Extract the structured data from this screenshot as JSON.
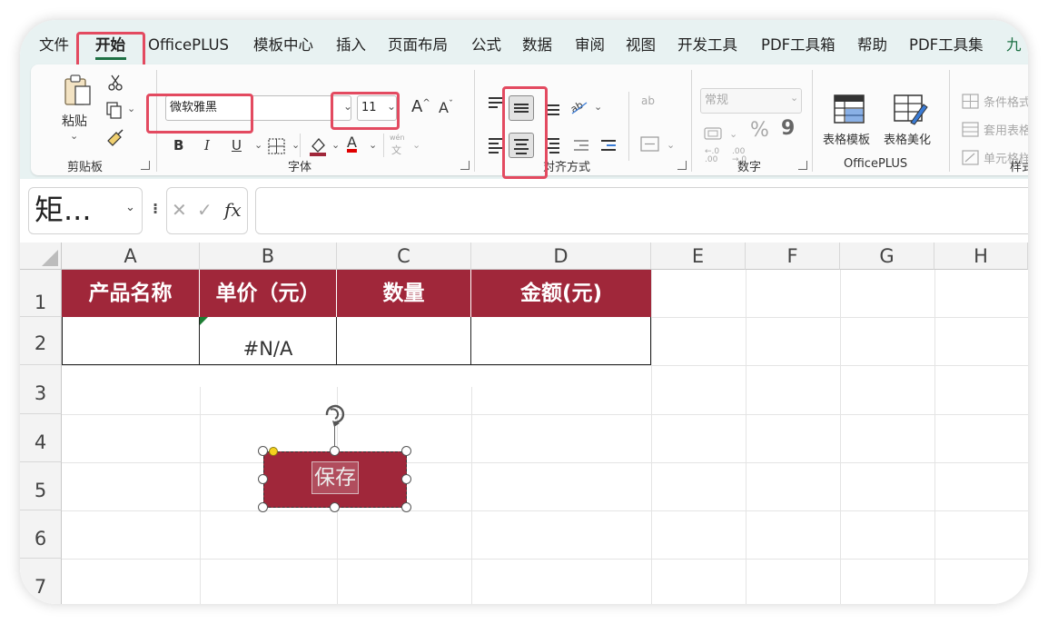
{
  "tabs": [
    {
      "label": "文件"
    },
    {
      "label": "开始",
      "active": true
    },
    {
      "label": "OfficePLUS"
    },
    {
      "label": "模板中心"
    },
    {
      "label": "插入"
    },
    {
      "label": "页面布局"
    },
    {
      "label": "公式"
    },
    {
      "label": "数据"
    },
    {
      "label": "审阅"
    },
    {
      "label": "视图"
    },
    {
      "label": "开发工具"
    },
    {
      "label": "PDF工具箱"
    },
    {
      "label": "帮助"
    },
    {
      "label": "PDF工具集"
    },
    {
      "label": "九"
    }
  ],
  "clipboard": {
    "paste_label": "粘贴",
    "group_label": "剪贴板"
  },
  "font": {
    "font_name": "微软雅黑",
    "font_size": "11",
    "bold": "B",
    "italic": "I",
    "underline": "U",
    "font_color_glyph": "A",
    "grow_glyph": "A",
    "shrink_glyph": "A",
    "phonetic_top": "wén",
    "phonetic_bottom": "文",
    "group_label": "字体"
  },
  "alignment": {
    "wrap_glyph": "ab",
    "group_label": "对齐方式"
  },
  "number": {
    "format_value": "常规",
    "percent": "%",
    "comma": "9",
    "group_label": "数字"
  },
  "officeplus": {
    "table_template": "表格模板",
    "table_beautify": "表格美化",
    "group_label": "OfficePLUS"
  },
  "styles": {
    "conditional": "条件格式",
    "table_format": "套用表格",
    "cell_styles": "单元格样",
    "group_label": "样式"
  },
  "formula_bar": {
    "name_box": "矩...",
    "fx": "fx",
    "formula": ""
  },
  "columns": [
    "A",
    "B",
    "C",
    "D",
    "E",
    "F",
    "G",
    "H"
  ],
  "rows": [
    "1",
    "2",
    "3",
    "4",
    "5",
    "6",
    "7"
  ],
  "table": {
    "headers": [
      "产品名称",
      "单价（元）",
      "数量",
      "金额(元)"
    ],
    "row2": [
      "",
      "#N/A",
      "",
      ""
    ]
  },
  "shape": {
    "label": "保存"
  },
  "colors": {
    "header_fill": "#a0273a",
    "accent_green": "#1e7145",
    "highlight": "#e34a60"
  }
}
